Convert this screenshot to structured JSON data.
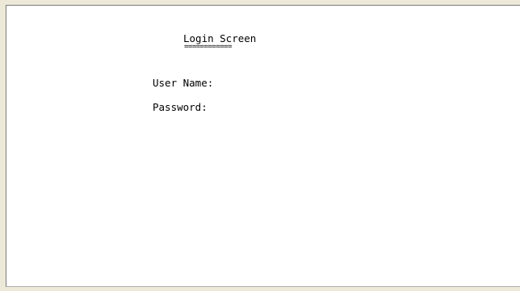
{
  "terminal": {
    "title": "Login Screen",
    "title_underline": "============",
    "fields": {
      "username_label": "User Name:",
      "username_value": "",
      "password_label": "Password:",
      "password_value": ""
    }
  }
}
